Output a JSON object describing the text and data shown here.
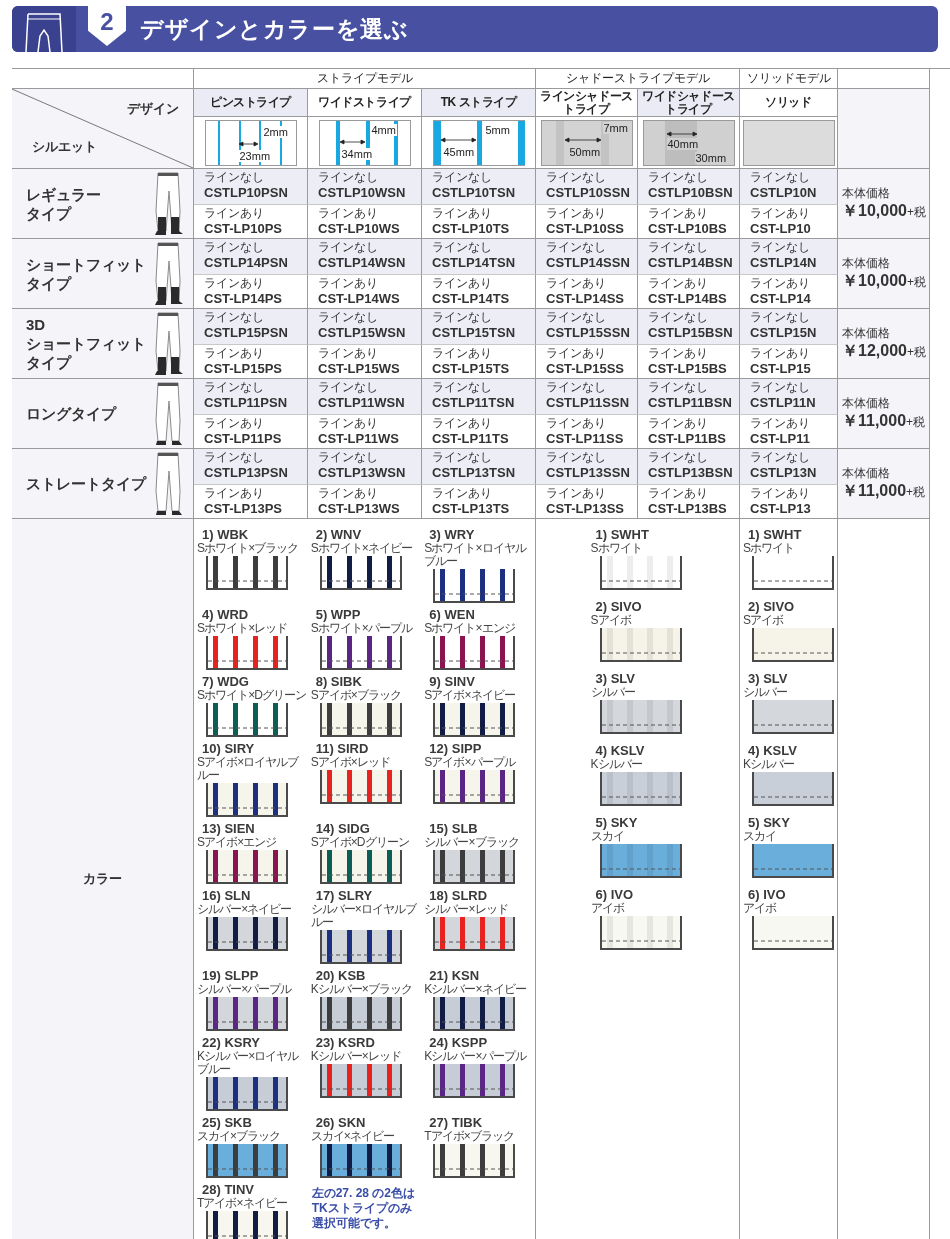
{
  "header": {
    "step": "2",
    "title": "デザインとカラーを選ぶ"
  },
  "corner": {
    "design_label": "デザイン",
    "silhouette_label": "シルエット"
  },
  "groups": [
    {
      "label": "ストライプモデル",
      "designs": [
        {
          "label": "ピンストライプ",
          "kind": "pin",
          "dims": [
            "2mm",
            "23mm"
          ]
        },
        {
          "label": "ワイドストライプ",
          "kind": "wide",
          "dims": [
            "4mm",
            "34mm"
          ]
        },
        {
          "label": "TK ストライプ",
          "kind": "tk",
          "dims": [
            "5mm",
            "45mm"
          ]
        }
      ]
    },
    {
      "label": "シャドーストライプモデル",
      "designs": [
        {
          "label": "ラインシャドーストライプ",
          "kind": "line-shadow",
          "dims": [
            "7mm",
            "50mm"
          ]
        },
        {
          "label": "ワイドシャドーストライプ",
          "kind": "wide-shadow",
          "dims": [
            "40mm",
            "30mm"
          ]
        }
      ]
    },
    {
      "label": "ソリッドモデル",
      "designs": [
        {
          "label": "ソリッド",
          "kind": "solid"
        }
      ]
    }
  ],
  "rows": [
    {
      "name_lines": [
        "レギュラー",
        "タイプ"
      ],
      "kind": "knee",
      "price_label": "本体価格",
      "price": "￥10,000",
      "tax": "+税",
      "models": [
        {
          "no_line_label": "ラインなし",
          "no_line": "CSTLP10PSN",
          "line_label": "ラインあり",
          "line": "CST-LP10PS"
        },
        {
          "no_line_label": "ラインなし",
          "no_line": "CSTLP10WSN",
          "line_label": "ラインあり",
          "line": "CST-LP10WS"
        },
        {
          "no_line_label": "ラインなし",
          "no_line": "CSTLP10TSN",
          "line_label": "ラインあり",
          "line": "CST-LP10TS"
        },
        {
          "no_line_label": "ラインなし",
          "no_line": "CSTLP10SSN",
          "line_label": "ラインあり",
          "line": "CST-LP10SS"
        },
        {
          "no_line_label": "ラインなし",
          "no_line": "CSTLP10BSN",
          "line_label": "ラインあり",
          "line": "CST-LP10BS"
        },
        {
          "no_line_label": "ラインなし",
          "no_line": "CSTLP10N",
          "line_label": "ラインあり",
          "line": "CST-LP10"
        }
      ]
    },
    {
      "name_lines": [
        "ショートフィット",
        "タイプ"
      ],
      "kind": "knee",
      "price_label": "本体価格",
      "price": "￥10,000",
      "tax": "+税",
      "models": [
        {
          "no_line_label": "ラインなし",
          "no_line": "CSTLP14PSN",
          "line_label": "ラインあり",
          "line": "CST-LP14PS"
        },
        {
          "no_line_label": "ラインなし",
          "no_line": "CSTLP14WSN",
          "line_label": "ラインあり",
          "line": "CST-LP14WS"
        },
        {
          "no_line_label": "ラインなし",
          "no_line": "CSTLP14TSN",
          "line_label": "ラインあり",
          "line": "CST-LP14TS"
        },
        {
          "no_line_label": "ラインなし",
          "no_line": "CSTLP14SSN",
          "line_label": "ラインあり",
          "line": "CST-LP14SS"
        },
        {
          "no_line_label": "ラインなし",
          "no_line": "CSTLP14BSN",
          "line_label": "ラインあり",
          "line": "CST-LP14BS"
        },
        {
          "no_line_label": "ラインなし",
          "no_line": "CSTLP14N",
          "line_label": "ラインあり",
          "line": "CST-LP14"
        }
      ]
    },
    {
      "name_lines": [
        "3D",
        "ショートフィット",
        "タイプ"
      ],
      "kind": "knee",
      "price_label": "本体価格",
      "price": "￥12,000",
      "tax": "+税",
      "models": [
        {
          "no_line_label": "ラインなし",
          "no_line": "CSTLP15PSN",
          "line_label": "ラインあり",
          "line": "CST-LP15PS"
        },
        {
          "no_line_label": "ラインなし",
          "no_line": "CSTLP15WSN",
          "line_label": "ラインあり",
          "line": "CST-LP15WS"
        },
        {
          "no_line_label": "ラインなし",
          "no_line": "CSTLP15TSN",
          "line_label": "ラインあり",
          "line": "CST-LP15TS"
        },
        {
          "no_line_label": "ラインなし",
          "no_line": "CSTLP15SSN",
          "line_label": "ラインあり",
          "line": "CST-LP15SS"
        },
        {
          "no_line_label": "ラインなし",
          "no_line": "CSTLP15BSN",
          "line_label": "ラインあり",
          "line": "CST-LP15BS"
        },
        {
          "no_line_label": "ラインなし",
          "no_line": "CSTLP15N",
          "line_label": "ラインあり",
          "line": "CST-LP15"
        }
      ]
    },
    {
      "name_lines": [
        "ロングタイプ"
      ],
      "kind": "long",
      "price_label": "本体価格",
      "price": "￥11,000",
      "tax": "+税",
      "models": [
        {
          "no_line_label": "ラインなし",
          "no_line": "CSTLP11PSN",
          "line_label": "ラインあり",
          "line": "CST-LP11PS"
        },
        {
          "no_line_label": "ラインなし",
          "no_line": "CSTLP11WSN",
          "line_label": "ラインあり",
          "line": "CST-LP11WS"
        },
        {
          "no_line_label": "ラインなし",
          "no_line": "CSTLP11TSN",
          "line_label": "ラインあり",
          "line": "CST-LP11TS"
        },
        {
          "no_line_label": "ラインなし",
          "no_line": "CSTLP11SSN",
          "line_label": "ラインあり",
          "line": "CST-LP11SS"
        },
        {
          "no_line_label": "ラインなし",
          "no_line": "CSTLP11BSN",
          "line_label": "ラインあり",
          "line": "CST-LP11BS"
        },
        {
          "no_line_label": "ラインなし",
          "no_line": "CSTLP11N",
          "line_label": "ラインあり",
          "line": "CST-LP11"
        }
      ]
    },
    {
      "name_lines": [
        "ストレートタイプ"
      ],
      "kind": "long",
      "price_label": "本体価格",
      "price": "￥11,000",
      "tax": "+税",
      "models": [
        {
          "no_line_label": "ラインなし",
          "no_line": "CSTLP13PSN",
          "line_label": "ラインあり",
          "line": "CST-LP13PS"
        },
        {
          "no_line_label": "ラインなし",
          "no_line": "CSTLP13WSN",
          "line_label": "ラインあり",
          "line": "CST-LP13WS"
        },
        {
          "no_line_label": "ラインなし",
          "no_line": "CSTLP13TSN",
          "line_label": "ラインあり",
          "line": "CST-LP13TS"
        },
        {
          "no_line_label": "ラインなし",
          "no_line": "CSTLP13SSN",
          "line_label": "ラインあり",
          "line": "CST-LP13SS"
        },
        {
          "no_line_label": "ラインなし",
          "no_line": "CSTLP13BSN",
          "line_label": "ラインあり",
          "line": "CST-LP13BS"
        },
        {
          "no_line_label": "ラインなし",
          "no_line": "CSTLP13N",
          "line_label": "ラインあり",
          "line": "CST-LP13"
        }
      ]
    }
  ],
  "colors": {
    "label": "カラー",
    "note_lines": [
      "左の27. 28 の2色は",
      "TKストライプのみ",
      "選択可能です。"
    ],
    "stripe": [
      {
        "label": "1) WBK",
        "name": "Sホワイト×ブラック",
        "kind": "white",
        "color": "#3d3d3d"
      },
      {
        "label": "2) WNV",
        "name": "Sホワイト×ネイビー",
        "kind": "white",
        "color": "#111d45"
      },
      {
        "label": "3) WRY",
        "name": "Sホワイト×ロイヤルブルー",
        "kind": "white",
        "color": "#1c2f80"
      },
      {
        "label": "4) WRD",
        "name": "Sホワイト×レッド",
        "kind": "white",
        "color": "#e8231f"
      },
      {
        "label": "5) WPP",
        "name": "Sホワイト×パープル",
        "kind": "white",
        "color": "#5b2585"
      },
      {
        "label": "6) WEN",
        "name": "Sホワイト×エンジ",
        "kind": "white",
        "color": "#8b1450"
      },
      {
        "label": "7) WDG",
        "name": "Sホワイト×Dグリーン",
        "kind": "white",
        "color": "#0a5e55"
      },
      {
        "label": "8) SIBK",
        "name": "Sアイボ×ブラック",
        "kind": "ivory",
        "color": "#3d3d3d"
      },
      {
        "label": "9) SINV",
        "name": "Sアイボ×ネイビー",
        "kind": "ivory",
        "color": "#111d45"
      },
      {
        "label": "10) SIRY",
        "name": "Sアイボ×ロイヤルブルー",
        "kind": "ivory",
        "color": "#1c2f80"
      },
      {
        "label": "11) SIRD",
        "name": "Sアイボ×レッド",
        "kind": "ivory",
        "color": "#e8231f"
      },
      {
        "label": "12) SIPP",
        "name": "Sアイボ×パープル",
        "kind": "ivory",
        "color": "#5b2585"
      },
      {
        "label": "13) SIEN",
        "name": "Sアイボ×エンジ",
        "kind": "ivory",
        "color": "#8b1450"
      },
      {
        "label": "14) SIDG",
        "name": "Sアイボ×Dグリーン",
        "kind": "ivory",
        "color": "#0a5e55"
      },
      {
        "label": "15) SLB",
        "name": "シルバー×ブラック",
        "kind": "silver",
        "color": "#3d3d3d"
      },
      {
        "label": "16) SLN",
        "name": "シルバー×ネイビー",
        "kind": "silver",
        "color": "#111d45"
      },
      {
        "label": "17) SLRY",
        "name": "シルバー×ロイヤルブルー",
        "kind": "silver",
        "color": "#1c2f80"
      },
      {
        "label": "18) SLRD",
        "name": "シルバー×レッド",
        "kind": "silver",
        "color": "#e8231f"
      },
      {
        "label": "19) SLPP",
        "name": "シルバー×パープル",
        "kind": "silver",
        "color": "#5b2585"
      },
      {
        "label": "20) KSB",
        "name": "Kシルバー×ブラック",
        "kind": "k-silver",
        "color": "#3d3d3d"
      },
      {
        "label": "21) KSN",
        "name": "Kシルバー×ネイビー",
        "kind": "k-silver",
        "color": "#111d45"
      },
      {
        "label": "22) KSRY",
        "name": "Kシルバー×ロイヤルブルー",
        "kind": "k-silver",
        "color": "#1c2f80"
      },
      {
        "label": "23) KSRD",
        "name": "Kシルバー×レッド",
        "kind": "k-silver",
        "color": "#e8231f"
      },
      {
        "label": "24) KSPP",
        "name": "Kシルバー×パープル",
        "kind": "k-silver",
        "color": "#5b2585"
      },
      {
        "label": "25) SKB",
        "name": "スカイ×ブラック",
        "kind": "sky",
        "color": "#3d3d3d"
      },
      {
        "label": "26) SKN",
        "name": "スカイ×ネイビー",
        "kind": "sky",
        "color": "#111d45"
      },
      {
        "label": "27) TIBK",
        "name": "Tアイボ×ブラック",
        "kind": "t-ivory",
        "color": "#3d3d3d"
      },
      {
        "label": "28) TINV",
        "name": "Tアイボ×ネイビー",
        "kind": "t-ivory",
        "color": "#111d45"
      }
    ],
    "shadow": [
      {
        "label": "1) SWHT",
        "name": "Sホワイト",
        "color": "#ffffff"
      },
      {
        "label": "2) SIVO",
        "name": "Sアイボ",
        "color": "#f6f4e8"
      },
      {
        "label": "3) SLV",
        "name": "シルバー",
        "color": "#d4d7db"
      },
      {
        "label": "4) KSLV",
        "name": "Kシルバー",
        "color": "#c9cfd9"
      },
      {
        "label": "5) SKY",
        "name": "スカイ",
        "color": "#6aaedb"
      },
      {
        "label": "6) IVO",
        "name": "アイボ",
        "color": "#f8f8f2"
      }
    ],
    "solid": [
      {
        "label": "1) SWHT",
        "name": "Sホワイト",
        "color": "#ffffff"
      },
      {
        "label": "2) SIVO",
        "name": "Sアイボ",
        "color": "#f6f4e8"
      },
      {
        "label": "3) SLV",
        "name": "シルバー",
        "color": "#d4d7db"
      },
      {
        "label": "4) KSLV",
        "name": "Kシルバー",
        "color": "#c9cfd9"
      },
      {
        "label": "5) SKY",
        "name": "スカイ",
        "color": "#6aaedb"
      },
      {
        "label": "6) IVO",
        "name": "アイボ",
        "color": "#f8f8f2"
      }
    ]
  }
}
